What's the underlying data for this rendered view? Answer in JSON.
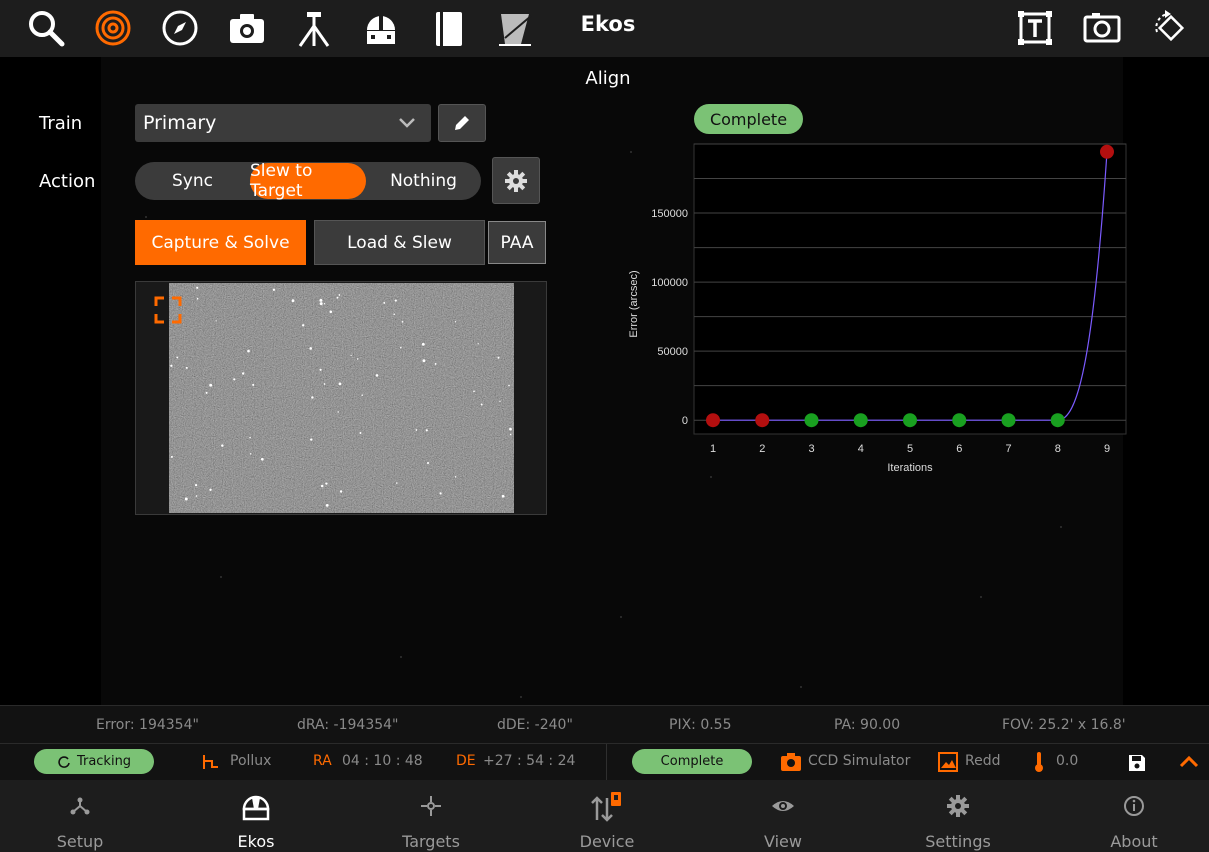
{
  "app": {
    "title": "Ekos"
  },
  "toolbar": {
    "icons": [
      "search-icon",
      "target-icon",
      "compass-icon",
      "camera-icon",
      "tripod-icon",
      "observatory-icon",
      "notebook-icon",
      "filter-icon",
      "text-frame-icon",
      "snapshot-icon",
      "rotate-icon"
    ]
  },
  "module": {
    "title": "Align"
  },
  "form": {
    "train_label": "Train",
    "train_value": "Primary",
    "action_label": "Action",
    "actions": [
      "Sync",
      "Slew to Target",
      "Nothing"
    ],
    "active_action": "Slew to Target",
    "capture_solve": "Capture & Solve",
    "load_slew": "Load & Slew",
    "paa": "PAA"
  },
  "status_badge": "Complete",
  "chart_data": {
    "type": "scatter",
    "x": [
      1,
      2,
      3,
      4,
      5,
      6,
      7,
      8,
      9
    ],
    "y": [
      0,
      0,
      0,
      0,
      0,
      0,
      0,
      0,
      194354
    ],
    "point_status": [
      "fail",
      "fail",
      "ok",
      "ok",
      "ok",
      "ok",
      "ok",
      "ok",
      "fail"
    ],
    "xlabel": "Iterations",
    "ylabel": "Error (arcsec)",
    "yticks": [
      0,
      50000,
      100000,
      150000
    ],
    "xticks": [
      "1",
      "2",
      "3",
      "4",
      "5",
      "6",
      "7",
      "8",
      "9"
    ],
    "ylim": [
      -10000,
      200000
    ],
    "grid": true,
    "colors": {
      "fail": "#b30f0f",
      "ok": "#19a020",
      "line": "#7b5bff"
    }
  },
  "solution": {
    "error": "Error: 194354\"",
    "dra": "dRA: -194354\"",
    "dde": "dDE: -240\"",
    "pix": "PIX: 0.55",
    "pa": "PA: 90.00",
    "fov": "FOV: 25.2' x 16.8'"
  },
  "statusbar": {
    "tracking": "Tracking",
    "target_name": "Pollux",
    "ra_label": "RA",
    "ra_value": "04 : 10 : 48",
    "de_label": "DE",
    "de_value": "+27 : 54 : 24",
    "align_state": "Complete",
    "camera": "CCD Simulator",
    "filter": "Redd",
    "temperature": "0.0"
  },
  "nav": [
    {
      "label": "Setup"
    },
    {
      "label": "Ekos"
    },
    {
      "label": "Targets"
    },
    {
      "label": "Device"
    },
    {
      "label": "View"
    },
    {
      "label": "Settings"
    },
    {
      "label": "About"
    }
  ],
  "colors": {
    "accent": "#ff6a00",
    "success": "#7bc275",
    "panel": "#1d1d1d"
  }
}
